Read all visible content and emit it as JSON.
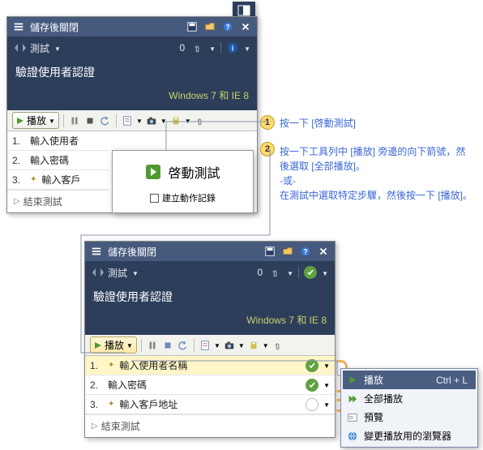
{
  "panel1": {
    "title": "儲存後關閉",
    "tab": "測試",
    "count": "0",
    "heading": "驗證使用者認證",
    "env": "Windows 7 和 IE 8",
    "play_label": "播放",
    "steps": [
      {
        "num": "1.",
        "txt": "輸入使用者"
      },
      {
        "num": "2.",
        "txt": "輸入密碼"
      },
      {
        "num": "3.",
        "glyph": "✦",
        "txt": "輸入客戶"
      }
    ],
    "footer": "結束測試"
  },
  "popup": {
    "title": "啓動測試",
    "checkbox_label": "建立動作記錄"
  },
  "panel2": {
    "title": "儲存後關閉",
    "tab": "測試",
    "count": "0",
    "heading": "驗證使用者認證",
    "env": "Windows 7 和 IE 8",
    "play_label": "播放",
    "steps": [
      {
        "num": "1.",
        "glyph": "✦",
        "txt": "輸入使用者名稱",
        "status": "pass"
      },
      {
        "num": "2.",
        "txt": "輸入密碼",
        "status": "pass"
      },
      {
        "num": "3.",
        "glyph": "✦",
        "txt": "輸入客戶地址",
        "status": "none"
      }
    ],
    "footer": "結束測試"
  },
  "menu": {
    "items": [
      {
        "icon": "play",
        "label": "播放",
        "shortcut": "Ctrl + L",
        "selected": true
      },
      {
        "icon": "play-all",
        "label": "全部播放"
      },
      {
        "icon": "preview",
        "label": "預覽"
      },
      {
        "icon": "browser",
        "label": "變更播放用的瀏覽器"
      }
    ]
  },
  "callouts": {
    "c1": "按一下 [啓動測試]",
    "c2": "按一下工具列中 [播放] 旁邊的向下箭號，然後選取 [全部播放]。\n-或-\n在測試中選取特定步驟，然後按一下 [播放]。"
  },
  "icons": {
    "save": "save-icon",
    "open": "open-icon",
    "help": "help-icon",
    "close": "close-icon",
    "attach": "attach-icon",
    "info": "info-icon"
  }
}
